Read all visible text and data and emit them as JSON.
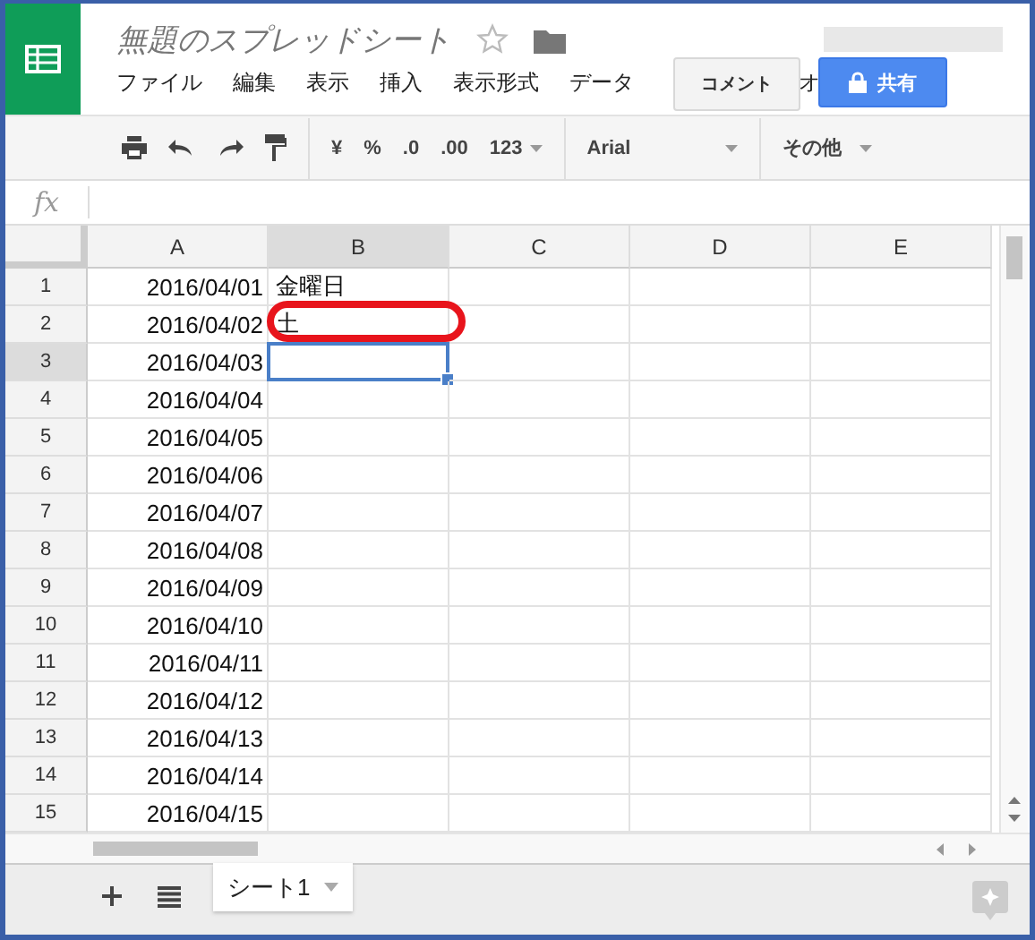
{
  "app": {
    "title": "無題のスプレッドシート",
    "starred": false
  },
  "menu": [
    "ファイル",
    "編集",
    "表示",
    "挿入",
    "表示形式",
    "データ",
    "オ"
  ],
  "comment_button": "コメント",
  "share_button": "共有",
  "toolbar": {
    "currency": "¥",
    "percent": "%",
    "decrease_decimal": ".0",
    "increase_decimal": ".00",
    "number_format": "123",
    "font": "Arial",
    "more": "その他"
  },
  "formula_bar": {
    "label": "fx"
  },
  "grid": {
    "columns": [
      {
        "label": "A",
        "selected": false
      },
      {
        "label": "B",
        "selected": true
      },
      {
        "label": "C",
        "selected": false
      },
      {
        "label": "D",
        "selected": false
      },
      {
        "label": "E",
        "selected": false
      }
    ],
    "rows": [
      {
        "label": "1",
        "selected": false,
        "cells": [
          {
            "text": "2016/04/01",
            "circled": false
          },
          {
            "text": "金曜日",
            "circled": false
          }
        ]
      },
      {
        "label": "2",
        "selected": false,
        "cells": [
          {
            "text": "2016/04/02",
            "circled": false
          },
          {
            "text": "土",
            "circled": true
          }
        ]
      },
      {
        "label": "3",
        "selected": true,
        "cells": [
          {
            "text": "2016/04/03",
            "circled": false
          }
        ]
      },
      {
        "label": "4",
        "selected": false,
        "cells": [
          {
            "text": "2016/04/04",
            "circled": false
          }
        ]
      },
      {
        "label": "5",
        "selected": false,
        "cells": [
          {
            "text": "2016/04/05",
            "circled": false
          }
        ]
      },
      {
        "label": "6",
        "selected": false,
        "cells": [
          {
            "text": "2016/04/06",
            "circled": false
          }
        ]
      },
      {
        "label": "7",
        "selected": false,
        "cells": [
          {
            "text": "2016/04/07",
            "circled": false
          }
        ]
      },
      {
        "label": "8",
        "selected": false,
        "cells": [
          {
            "text": "2016/04/08",
            "circled": false
          }
        ]
      },
      {
        "label": "9",
        "selected": false,
        "cells": [
          {
            "text": "2016/04/09",
            "circled": false
          }
        ]
      },
      {
        "label": "10",
        "selected": false,
        "cells": [
          {
            "text": "2016/04/10",
            "circled": false
          }
        ]
      },
      {
        "label": "11",
        "selected": false,
        "cells": [
          {
            "text": "2016/04/11",
            "circled": false
          }
        ]
      },
      {
        "label": "12",
        "selected": false,
        "cells": [
          {
            "text": "2016/04/12",
            "circled": false
          }
        ]
      },
      {
        "label": "13",
        "selected": false,
        "cells": [
          {
            "text": "2016/04/13",
            "circled": false
          }
        ]
      },
      {
        "label": "14",
        "selected": false,
        "cells": [
          {
            "text": "2016/04/14",
            "circled": false
          }
        ]
      },
      {
        "label": "15",
        "selected": false,
        "cells": [
          {
            "text": "2016/04/15",
            "circled": false
          }
        ]
      }
    ]
  },
  "sheets": [
    {
      "label": "シート1",
      "selected": true
    }
  ]
}
